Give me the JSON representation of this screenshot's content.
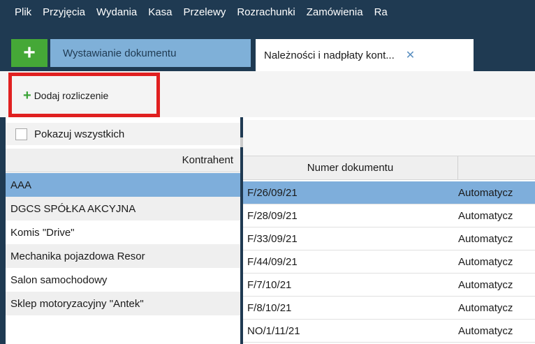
{
  "menu": [
    "Plik",
    "Przyjęcia",
    "Wydania",
    "Kasa",
    "Przelewy",
    "Rozrachunki",
    "Zamówienia",
    "Ra"
  ],
  "tabs": {
    "add_label": "+",
    "items": [
      {
        "label": "Wystawianie dokumentu"
      },
      {
        "label": "Należności i nadpłaty kont...",
        "close": "✕"
      }
    ]
  },
  "toolbar": {
    "add_settlement_plus": "+",
    "add_settlement_label": "Dodaj rozliczenie"
  },
  "left_panel": {
    "show_all_label": "Pokazuj wszystkich",
    "column_header": "Kontrahent",
    "rows": [
      {
        "name": "AAA"
      },
      {
        "name": "DGCS SPÓŁKA AKCYJNA"
      },
      {
        "name": "Komis \"Drive\""
      },
      {
        "name": "Mechanika pojazdowa Resor"
      },
      {
        "name": "Salon samochodowy"
      },
      {
        "name": "Sklep motoryzacyjny \"Antek\""
      }
    ]
  },
  "right_panel": {
    "column_header": "Numer dokumentu",
    "rows": [
      {
        "num": "F/26/09/21",
        "status": "Automatycz"
      },
      {
        "num": "F/28/09/21",
        "status": "Automatycz"
      },
      {
        "num": "F/33/09/21",
        "status": "Automatycz"
      },
      {
        "num": "F/44/09/21",
        "status": "Automatycz"
      },
      {
        "num": "F/7/10/21",
        "status": "Automatycz"
      },
      {
        "num": "F/8/10/21",
        "status": "Automatycz"
      },
      {
        "num": "NO/1/11/21",
        "status": "Automatycz"
      }
    ]
  }
}
